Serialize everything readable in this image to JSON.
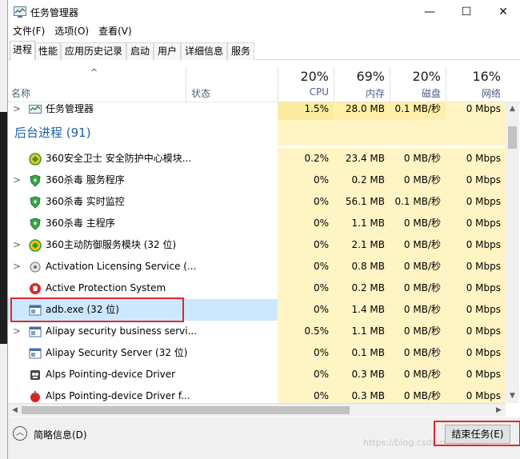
{
  "window": {
    "title": "任务管理器",
    "controls": {
      "minimize": "—",
      "maximize": "☐",
      "close": "✕"
    }
  },
  "menu": [
    "文件(F)",
    "选项(O)",
    "查看(V)"
  ],
  "tabs": [
    "进程",
    "性能",
    "应用历史记录",
    "启动",
    "用户",
    "详细信息",
    "服务"
  ],
  "active_tab": "进程",
  "columns": {
    "sort_indicator": "^",
    "name": "名称",
    "status": "状态",
    "cpu": {
      "percent": "20%",
      "label": "CPU"
    },
    "memory": {
      "percent": "69%",
      "label": "内存"
    },
    "disk": {
      "percent": "20%",
      "label": "磁盘"
    },
    "network": {
      "percent": "16%",
      "label": "网络"
    }
  },
  "apps_partial_row": {
    "name": "任务管理器",
    "icon": "task-manager-icon",
    "expander": ">",
    "cpu": "1.5%",
    "memory": "28.0 MB",
    "disk": "0.1 MB/秒",
    "network": "0 Mbps"
  },
  "background_group": "后台进程 (91)",
  "processes": [
    {
      "name": "360安全卫士 安全防护中心模块...",
      "icon": "360-safeguard-icon",
      "expander": "",
      "cpu": "0.2%",
      "memory": "23.4 MB",
      "disk": "0 MB/秒",
      "network": "0 Mbps"
    },
    {
      "name": "360杀毒 服务程序",
      "icon": "360-antivirus-shield-icon",
      "expander": ">",
      "cpu": "0%",
      "memory": "0.2 MB",
      "disk": "0 MB/秒",
      "network": "0 Mbps"
    },
    {
      "name": "360杀毒 实时监控",
      "icon": "360-antivirus-shield-icon",
      "expander": "",
      "cpu": "0%",
      "memory": "56.1 MB",
      "disk": "0.1 MB/秒",
      "network": "0 Mbps"
    },
    {
      "name": "360杀毒 主程序",
      "icon": "360-antivirus-shield-icon",
      "expander": "",
      "cpu": "0%",
      "memory": "1.1 MB",
      "disk": "0 MB/秒",
      "network": "0 Mbps"
    },
    {
      "name": "360主动防御服务模块 (32 位)",
      "icon": "360-safeguard-icon",
      "expander": ">",
      "cpu": "0%",
      "memory": "2.1 MB",
      "disk": "0 MB/秒",
      "network": "0 Mbps"
    },
    {
      "name": "Activation Licensing Service (...",
      "icon": "service-gear-icon",
      "expander": ">",
      "cpu": "0%",
      "memory": "0.8 MB",
      "disk": "0 MB/秒",
      "network": "0 Mbps"
    },
    {
      "name": "Active Protection System",
      "icon": "red-shield-icon",
      "expander": "",
      "cpu": "0%",
      "memory": "0.2 MB",
      "disk": "0 MB/秒",
      "network": "0 Mbps"
    },
    {
      "name": "adb.exe (32 位)",
      "icon": "window-app-icon",
      "expander": "",
      "cpu": "0%",
      "memory": "1.4 MB",
      "disk": "0 MB/秒",
      "network": "0 Mbps",
      "selected": true
    },
    {
      "name": "Alipay security business servi...",
      "icon": "window-app-icon",
      "expander": ">",
      "cpu": "0.5%",
      "memory": "1.1 MB",
      "disk": "0 MB/秒",
      "network": "0 Mbps"
    },
    {
      "name": "Alipay Security Server (32 位)",
      "icon": "window-app-icon",
      "expander": "",
      "cpu": "0%",
      "memory": "0.1 MB",
      "disk": "0 MB/秒",
      "network": "0 Mbps"
    },
    {
      "name": "Alps Pointing-device Driver",
      "icon": "alps-driver-icon",
      "expander": "",
      "cpu": "0%",
      "memory": "0.3 MB",
      "disk": "0 MB/秒",
      "network": "0 Mbps"
    },
    {
      "name": "Alps Pointing-device Driver f...",
      "icon": "alps-red-icon",
      "expander": "",
      "cpu": "0%",
      "memory": "0.3 MB",
      "disk": "0 MB/秒",
      "network": "0 Mbps"
    }
  ],
  "footer": {
    "fewer_details": "简略信息(D)",
    "end_task": "结束任务(E)",
    "watermark": "https://blog.csdn.net/weixin"
  },
  "colors": {
    "accent_blue": "#1e5fa8",
    "selection": "#cce8ff",
    "heat_light": "#fff4c4",
    "annotation_red": "#e0282d"
  }
}
